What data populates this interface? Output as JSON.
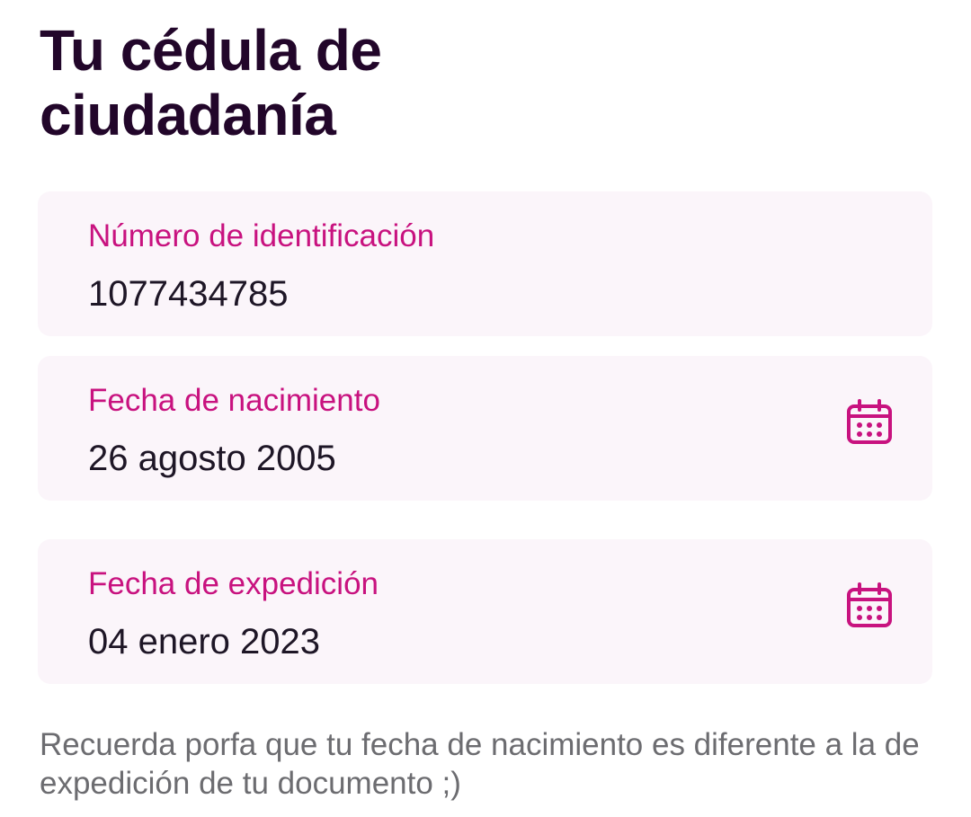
{
  "page": {
    "title": "Tu cédula de ciudadanía"
  },
  "fields": [
    {
      "label": "Número de identificación",
      "value": "1077434785"
    },
    {
      "label": "Fecha de nacimiento",
      "value": "26 agosto 2005",
      "icon": "calendar-icon"
    },
    {
      "label": "Fecha de expedición",
      "value": "04 enero 2023",
      "icon": "calendar-icon"
    }
  ],
  "hint": "Recuerda porfa que tu fecha de nacimiento es diferente a la de expedición de tu documento ;)",
  "colors": {
    "accent": "#c8127f",
    "title": "#22062a",
    "field_background": "#fbf5fa",
    "hint_text": "#6c6c70"
  }
}
